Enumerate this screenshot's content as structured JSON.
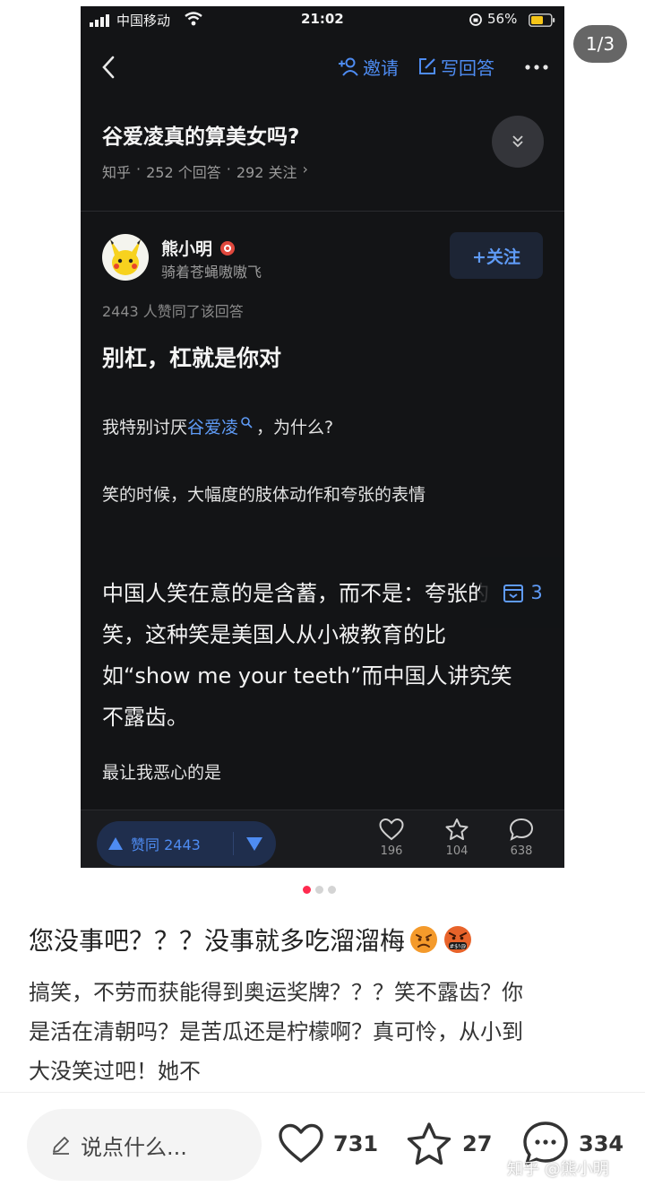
{
  "screenshot": {
    "status_bar": {
      "carrier": "中国移动",
      "time": "21:02",
      "battery": "56%"
    },
    "nav": {
      "invite_label": "邀请",
      "write_label": "写回答"
    },
    "question": {
      "title": "谷爱凌真的算美女吗?",
      "source": "知乎",
      "answers": "252 个回答",
      "follows": "292 关注",
      "meta_sep": "·",
      "chevron": "›"
    },
    "author": {
      "name": "熊小明",
      "bio": "骑着苍蝇嗷嗷飞",
      "follow_label": "+关注"
    },
    "answer": {
      "upvote_note": "2443 人赞同了该回答",
      "heading": "别杠，杠就是你对",
      "p1_before": "我特别讨厌",
      "p1_link": "谷爱凌",
      "p1_after": "，为什么?",
      "p2": "笑的时候，大幅度的肢体动作和夸张的表情",
      "p3": "中国人笑在意的是含蓄，而不是：夸张的笑，这种笑是美国人从小被教育的比如“show me your teeth”而中国人讲究笑不露齿。",
      "p4": "最让我恶心的是",
      "fold_count": "3"
    },
    "actions": {
      "vote_label": "赞同 2443",
      "likes": "196",
      "favorites": "104",
      "comments": "638"
    }
  },
  "post": {
    "page_indicator": "1/3",
    "title": "您没事吧？？？没事就多吃溜溜梅",
    "body": "搞笑，不劳而获能得到奥运奖牌？？？笑不露齿？你是活在清朝吗？是苦瓜还是柠檬啊？真可怜，从小到大没笑过吧！她不",
    "comment_placeholder": "说点什么...",
    "likes": "731",
    "collects": "27",
    "comments": "334",
    "watermark": "知乎 @熊小明"
  },
  "colors": {
    "accent_blue": "#4e8cf2",
    "active_dot": "#ff2a4f",
    "dark_bg": "#131416"
  },
  "icons": [
    "back-icon",
    "invite-icon",
    "write-icon",
    "more-icon",
    "collapse-icon",
    "badge-icon",
    "search-icon",
    "fold-icon",
    "upvote-icon",
    "downvote-icon",
    "heart-icon",
    "star-icon",
    "comment-icon",
    "pencil-icon",
    "angry-emoji",
    "cursing-emoji"
  ]
}
